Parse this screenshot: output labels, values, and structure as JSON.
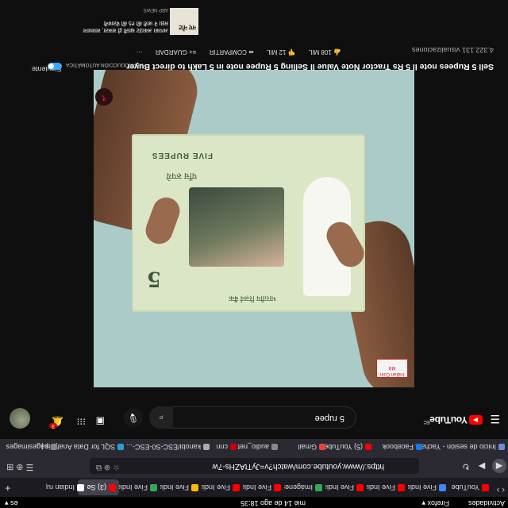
{
  "system": {
    "activities": "Actividades",
    "app_menu": "Firefox ▾",
    "clock": "mié 14 de ago  18:35",
    "tray": "es ▾"
  },
  "tabs": [
    {
      "label": "YouTube",
      "color": "#ff0000",
      "active": false
    },
    {
      "label": "Five India",
      "color": "#4285f4",
      "active": false
    },
    {
      "label": "Five India",
      "color": "#ff0000",
      "active": false
    },
    {
      "label": "Five India",
      "color": "#ff0000",
      "active": false
    },
    {
      "label": "Imágenes",
      "color": "#34a853",
      "active": false
    },
    {
      "label": "Five India",
      "color": "#ff0000",
      "active": false
    },
    {
      "label": "Five India",
      "color": "#ff0000",
      "active": false
    },
    {
      "label": "Five India",
      "color": "#fbbc05",
      "active": false
    },
    {
      "label": "Five India",
      "color": "#34a853",
      "active": false
    },
    {
      "label": "(3) Se",
      "color": "#ff0000",
      "active": true
    },
    {
      "label": "Indian rupi",
      "color": "#ffffff",
      "active": false
    }
  ],
  "navbar": {
    "url": "https://www.youtube.com/watch?v=JyTtAZHs-7w",
    "url_icons": "☆ ⊕ ⧉"
  },
  "bookmarks": [
    {
      "label": "Inicio de sesión - Yacha...",
      "color": "#6a8fd6"
    },
    {
      "label": "Facebook",
      "color": "#1877f2"
    },
    {
      "label": "(5) YouTube",
      "color": "#ff0000"
    },
    {
      "label": "Gmail",
      "color": "#ea4335"
    },
    {
      "label": "audio_net",
      "color": "#888888"
    },
    {
      "label": "cnn",
      "color": "#cc0000"
    },
    {
      "label": "kanobi/ESC-S0-ESC-...",
      "color": "#aaaaaa"
    },
    {
      "label": "SQL for Data Analysis |...",
      "color": "#2b9dd8"
    },
    {
      "label": "pagesimages",
      "color": "#888888"
    }
  ],
  "youtube": {
    "logo": "YouTube",
    "logo_suffix": "EC",
    "search_query": "5 rupee",
    "notification_count": "3"
  },
  "video": {
    "title": "Sell 5 Rupees note ll 5 Rs Tractor Note Value ll Selling 5 Rupee note in 5 Lakh to direct Buyer",
    "views": "4.322.131 visualizaciones",
    "watermark": "Indian Coin Mill",
    "note_five": "5",
    "note_five_rupees": "FIVE RUPEES",
    "note_hindi_top": "भारतीय रिज़र्व बैंक",
    "note_hindi_bottom": "पाँच रुपये"
  },
  "actions": {
    "likes": "108 MIL",
    "dislikes": "12 MIL",
    "share": "COMPARTIR",
    "save": "GUARDAR",
    "more": "···"
  },
  "sidebar": {
    "autoplay_label": "REPRODUCCIÓN AUTOMÁTICA",
    "next_label": "Siguiente",
    "next_title": "नए नोट",
    "next_text": "आपका अकाउंट खाली हो सकता, सावधान! RBI ने जारी की ₹5 की चेतावनी",
    "next_channel": "ABP NEWS"
  }
}
